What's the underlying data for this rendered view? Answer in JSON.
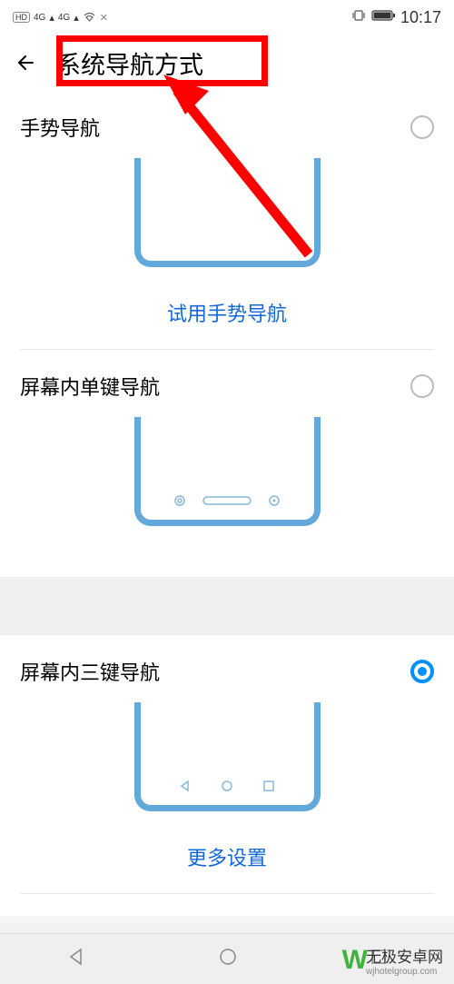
{
  "status": {
    "hd1": "HD",
    "fourG": "4G",
    "time": "10:17"
  },
  "header": {
    "title": "系统导航方式"
  },
  "options": [
    {
      "label": "手势导航",
      "link": "试用手势导航",
      "selected": false
    },
    {
      "label": "屏幕内单键导航",
      "link": "",
      "selected": false
    },
    {
      "label": "屏幕内三键导航",
      "link": "更多设置",
      "selected": true
    }
  ],
  "watermark": {
    "main": "无极安卓网",
    "sub": "wjhotelgroup.com"
  }
}
